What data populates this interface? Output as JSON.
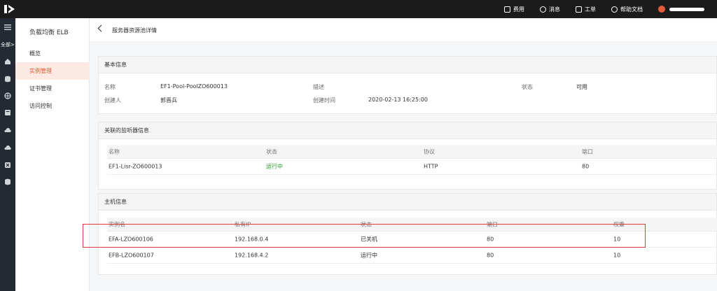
{
  "topbar": {
    "items": [
      {
        "icon": "billing-icon",
        "label": "费用"
      },
      {
        "icon": "message-icon",
        "label": "消息"
      },
      {
        "icon": "ticket-icon",
        "label": "工单"
      },
      {
        "icon": "help-icon",
        "label": "帮助文档"
      }
    ]
  },
  "rail": {
    "all_label": "全部>"
  },
  "sidebar": {
    "title": "负载均衡 ELB",
    "items": [
      {
        "label": "概览"
      },
      {
        "label": "实例管理"
      },
      {
        "label": "证书管理"
      },
      {
        "label": "访问控制"
      }
    ]
  },
  "page": {
    "title": "服务器资源池详情"
  },
  "basic": {
    "title": "基本信息",
    "name_label": "名称",
    "name_value": "EF1-Pool-PoolZO600013",
    "desc_label": "描述",
    "status_label": "状态",
    "status_value": "可用",
    "creator_label": "创建人",
    "creator_value": "郭晋兵",
    "created_label": "创建时间",
    "created_value": "2020-02-13 16:25:00"
  },
  "listener": {
    "title": "关联的监听器信息",
    "headers": [
      "名称",
      "状态",
      "协议",
      "端口"
    ],
    "rows": [
      [
        "EF1-Lisr-ZO600013",
        "运行中",
        "HTTP",
        "80"
      ]
    ]
  },
  "hosts": {
    "title": "主机信息",
    "headers": [
      "实例名",
      "私有IP",
      "状态",
      "端口",
      "权重"
    ],
    "rows": [
      [
        "EFA-LZO600106",
        "192.168.0.4",
        "已关机",
        "80",
        "10"
      ],
      [
        "EFB-LZO600107",
        "192.168.4.2",
        "运行中",
        "80",
        "10"
      ]
    ]
  },
  "colors": {
    "accent": "#e8542f",
    "running": "#2ba02b",
    "highlight": "#e23a3a"
  }
}
